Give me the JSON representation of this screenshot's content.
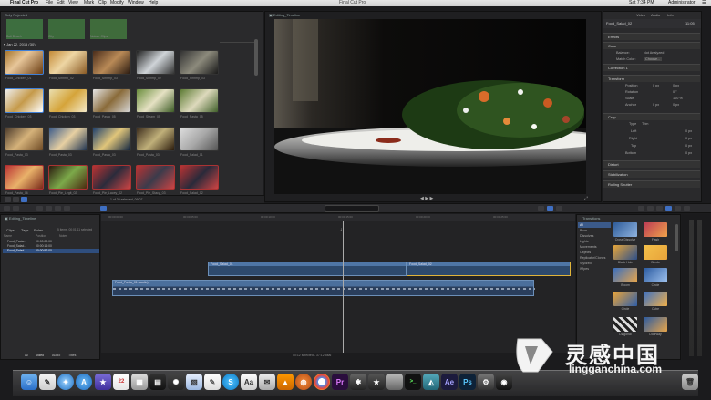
{
  "menubar": {
    "app_name": "Final Cut Pro",
    "items": [
      "File",
      "Edit",
      "View",
      "Mark",
      "Clip",
      "Modify",
      "Window",
      "Help"
    ],
    "window_title": "Final Cut Pro",
    "clock": "Sat 7:34 PM",
    "user": "Administrator"
  },
  "browser": {
    "title": "Only Rejected",
    "top_clips": [
      "Bali Beach",
      "City",
      "Nature Clips"
    ],
    "date_group": "Jan 22, 2015",
    "date_count": "(30)",
    "labels_row1": [
      "Food_Chicken_01",
      "Food_Shrimp_02",
      "Food_Shrimp_03",
      "Food_Shrimp_02",
      "Food_Shrimp_03"
    ],
    "labels_row2": [
      "Food_Chicken_03",
      "Food_Chicken_03",
      "Food_Pasta_05",
      "Food_Steam_05",
      "Food_Pasta_05"
    ],
    "labels_row3": [
      "Food_Pasta_03",
      "Food_Pasta_03",
      "Food_Pasta_03",
      "Food_Pasta_03",
      "Food_Salad_01"
    ],
    "labels_row4": [
      "Food_Pasta_06",
      "Food_Pie_Legit_02",
      "Food_Pie_Lacey_02",
      "Food_Pie_Stacy_03",
      "Food_Salad_02"
    ],
    "footer": "1 of 30 selected, 09:07"
  },
  "viewer": {
    "title": "Editing_Timeline"
  },
  "inspector": {
    "tabs": [
      "Video",
      "Audio",
      "Info"
    ],
    "clip_name": "Food_Salad_02",
    "clip_time": "11:05",
    "sections": [
      {
        "name": "Effects"
      },
      {
        "name": "Color"
      },
      {
        "name": "Correction 1"
      },
      {
        "name": "Transform"
      },
      {
        "name": "Crop"
      },
      {
        "name": "Distort"
      },
      {
        "name": "Stabilization"
      },
      {
        "name": "Rolling Shutter"
      }
    ],
    "color_rows": [
      "Balance:",
      "Match Color:"
    ],
    "color_values": [
      "Not Analyzed",
      "Choose..."
    ],
    "transform_rows": [
      "Position",
      "Rotation",
      "Scale",
      "Anchor"
    ],
    "transform_values": [
      "0 px",
      "0 px",
      "0 °",
      "100 %",
      "0 px",
      "0 px"
    ],
    "crop_rows": [
      "Type",
      "Left",
      "Right",
      "Top",
      "Bottom"
    ],
    "crop_values": [
      "Trim",
      "0 px",
      "0 px",
      "0 px",
      "0 px"
    ]
  },
  "timeline_index": {
    "title": "Editing_Timeline",
    "tabs": [
      "Clips",
      "Tags",
      "Roles"
    ],
    "summary": "5 items, 00:01:11 selected",
    "columns": [
      "Name",
      "Position",
      "Notes"
    ],
    "rows": [
      {
        "name": "Food_Pasta...",
        "pos": "00:00:00:00"
      },
      {
        "name": "Food_Salad...",
        "pos": "00:00:16:00"
      },
      {
        "name": "Food_Salad...",
        "pos": "00:00:57:00"
      }
    ],
    "bottom_tabs": [
      "All",
      "Video",
      "Audio",
      "Titles"
    ]
  },
  "timeline": {
    "clips": [
      {
        "name": "Food_Salad_01"
      },
      {
        "name": "Food_Salad_02"
      },
      {
        "name": "Food_Pasta_01 (audio)"
      }
    ],
    "status": "00:12 selected - 37:12 total",
    "ruler": [
      "00:00:00:00",
      "00:00:05:00",
      "00:00:10:00",
      "00:00:15:00",
      "00:00:20:00",
      "00:00:25:00"
    ]
  },
  "transitions": {
    "title": "Transitions",
    "count": "All",
    "categories": [
      "All",
      "Blurs",
      "Dissolves",
      "Lights",
      "Movements",
      "Objects",
      "Replicator/Clones",
      "Stylized",
      "Wipes"
    ],
    "items": [
      "Cross Dissolve",
      "Flash",
      "Black Hole",
      "Blinds",
      "Bloom",
      "Circle",
      "Circle",
      "Cube",
      "Diagonal",
      "Doorway"
    ]
  },
  "watermark": {
    "cn_text": "灵感中国",
    "url": "lingganchina.com"
  },
  "dock": {
    "icons": [
      "finder-icon",
      "notes-icon",
      "safari-icon",
      "app-store-icon",
      "imovie-icon",
      "calendar-icon",
      "photo-icon",
      "clapper-icon",
      "iphoto-icon",
      "preview-icon",
      "textedit-icon",
      "skype-icon",
      "dictionary-icon",
      "mail-icon",
      "vlc-icon",
      "basketball-icon",
      "chrome-icon",
      "premiere-icon",
      "compressor-icon",
      "motion-icon",
      "apple-icon",
      "terminal-icon",
      "maps-icon",
      "after-effects-icon",
      "photoshop-icon",
      "tools-icon",
      "camera-icon",
      "trash-icon"
    ]
  }
}
